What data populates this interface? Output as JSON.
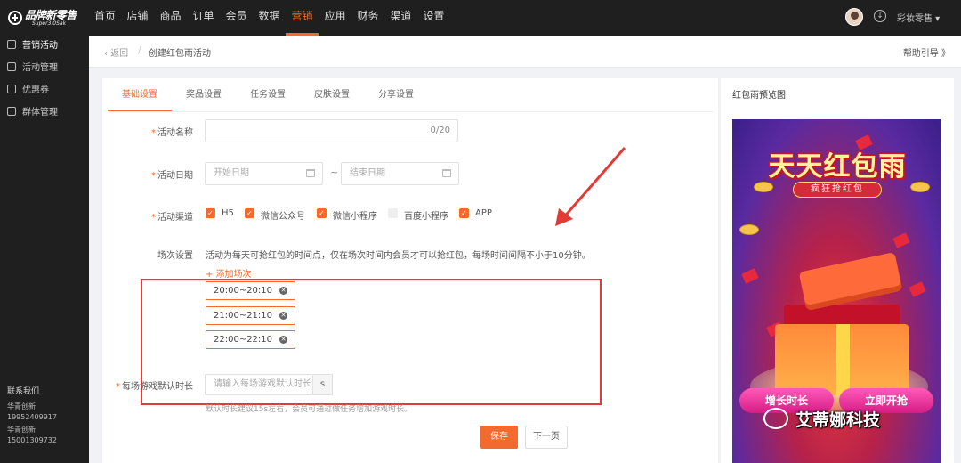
{
  "app": {
    "logo_text": "品牌新零售",
    "logo_sub": "Super3.0Sak",
    "store_name": "彩妆零售 ▾"
  },
  "nav": [
    "首页",
    "店铺",
    "商品",
    "订单",
    "会员",
    "数据",
    "营销",
    "应用",
    "财务",
    "渠道",
    "设置"
  ],
  "nav_active": "营销",
  "sidebar": {
    "items": [
      "营销活动",
      "活动管理",
      "优惠券",
      "群体管理"
    ],
    "contact_title": "联系我们",
    "contacts": [
      {
        "name": "华青创新",
        "phone": "19952409917"
      },
      {
        "name": "华青创新",
        "phone": "15001309732"
      }
    ]
  },
  "header": {
    "back": "返回",
    "title": "创建红包雨活动",
    "help": "帮助引导 》"
  },
  "tabs": [
    "基础设置",
    "奖品设置",
    "任务设置",
    "皮肤设置",
    "分享设置"
  ],
  "tab_active": "基础设置",
  "form": {
    "name_label": "活动名称",
    "name_counter": "0/20",
    "date_label": "活动日期",
    "start_placeholder": "开始日期",
    "end_placeholder": "结束日期",
    "date_sep": "~",
    "channel_label": "活动渠道",
    "channels": [
      {
        "label": "H5",
        "checked": true
      },
      {
        "label": "微信公众号",
        "checked": true
      },
      {
        "label": "微信小程序",
        "checked": true
      },
      {
        "label": "百度小程序",
        "checked": false
      },
      {
        "label": "APP",
        "checked": true
      }
    ],
    "session_label": "场次设置",
    "session_desc": "活动为每天可抢红包的时间点，仅在场次时间内会员才可以抢红包，每场时间间隔不小于10分钟。",
    "add_session": "+ 添加场次",
    "sessions": [
      "20:00~20:10",
      "21:00~21:10",
      "22:00~22:10"
    ],
    "duration_label": "每场游戏默认时长",
    "duration_placeholder": "请输入每场游戏默认时长",
    "duration_unit": "s",
    "duration_hint": "默认时长建议15s左右，会员可通过做任务增加游戏时长。",
    "save": "保存",
    "next": "下一页"
  },
  "preview": {
    "title": "红包雨预览图",
    "banner": "天天红包雨",
    "sub": "疯狂抢红包",
    "btn_left": "增长时长",
    "btn_right": "立即开抢"
  },
  "watermark": "艾蒂娜科技",
  "colors": {
    "accent": "#f26a2e",
    "highlight": "#e53935",
    "sidebar_bg": "#1f1f1f"
  }
}
